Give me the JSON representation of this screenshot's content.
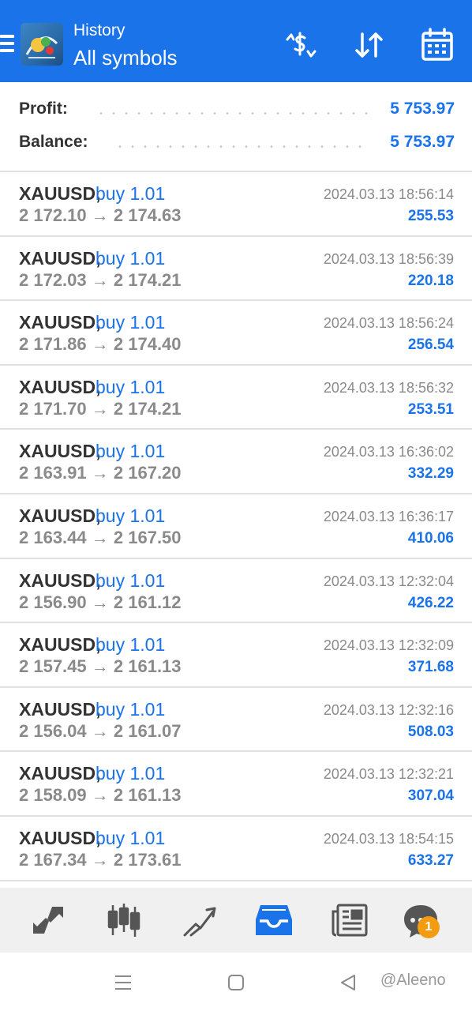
{
  "header": {
    "subtitle": "History",
    "title": "All symbols",
    "background": "#1a73e8",
    "icons": [
      "menu-icon",
      "app-logo",
      "currency-exchange-icon",
      "sort-icon",
      "calendar-icon"
    ]
  },
  "summary": {
    "profit_label": "Profit:",
    "profit_value": "5 753.97",
    "balance_label": "Balance:",
    "balance_value": "5 753.97"
  },
  "deals": [
    {
      "symbol": "XAUUSD,",
      "side": "buy 1.01",
      "open": "2 172.10",
      "close": "2 174.63",
      "arrow": "→",
      "time": "2024.03.13 18:56:14",
      "profit": "255.53"
    },
    {
      "symbol": "XAUUSD,",
      "side": "buy 1.01",
      "open": "2 172.03",
      "close": "2 174.21",
      "arrow": "→",
      "time": "2024.03.13 18:56:39",
      "profit": "220.18"
    },
    {
      "symbol": "XAUUSD,",
      "side": "buy 1.01",
      "open": "2 171.86",
      "close": "2 174.40",
      "arrow": "→",
      "time": "2024.03.13 18:56:24",
      "profit": "256.54"
    },
    {
      "symbol": "XAUUSD,",
      "side": "buy 1.01",
      "open": "2 171.70",
      "close": "2 174.21",
      "arrow": "→",
      "time": "2024.03.13 18:56:32",
      "profit": "253.51"
    },
    {
      "symbol": "XAUUSD,",
      "side": "buy 1.01",
      "open": "2 163.91",
      "close": "2 167.20",
      "arrow": "→",
      "time": "2024.03.13 16:36:02",
      "profit": "332.29"
    },
    {
      "symbol": "XAUUSD,",
      "side": "buy 1.01",
      "open": "2 163.44",
      "close": "2 167.50",
      "arrow": "→",
      "time": "2024.03.13 16:36:17",
      "profit": "410.06"
    },
    {
      "symbol": "XAUUSD,",
      "side": "buy 1.01",
      "open": "2 156.90",
      "close": "2 161.12",
      "arrow": "→",
      "time": "2024.03.13 12:32:04",
      "profit": "426.22"
    },
    {
      "symbol": "XAUUSD,",
      "side": "buy 1.01",
      "open": "2 157.45",
      "close": "2 161.13",
      "arrow": "→",
      "time": "2024.03.13 12:32:09",
      "profit": "371.68"
    },
    {
      "symbol": "XAUUSD,",
      "side": "buy 1.01",
      "open": "2 156.04",
      "close": "2 161.07",
      "arrow": "→",
      "time": "2024.03.13 12:32:16",
      "profit": "508.03"
    },
    {
      "symbol": "XAUUSD,",
      "side": "buy 1.01",
      "open": "2 158.09",
      "close": "2 161.13",
      "arrow": "→",
      "time": "2024.03.13 12:32:21",
      "profit": "307.04"
    },
    {
      "symbol": "XAUUSD,",
      "side": "buy 1.01",
      "open": "2 167.34",
      "close": "2 173.61",
      "arrow": "→",
      "time": "2024.03.13 18:54:15",
      "profit": "633.27"
    }
  ],
  "tabbar": {
    "icons": [
      "quotes-icon",
      "chart-candles-icon",
      "trade-icon",
      "history-inbox-icon",
      "news-icon",
      "chat-icon"
    ],
    "active": "history-inbox-icon",
    "active_color": "#1a73e8",
    "chat_badge": "1",
    "badge_color": "#f39c12"
  },
  "system_nav": {
    "icons": [
      "recent-apps-icon",
      "home-icon",
      "back-icon"
    ],
    "watermark": "@Aleeno"
  }
}
